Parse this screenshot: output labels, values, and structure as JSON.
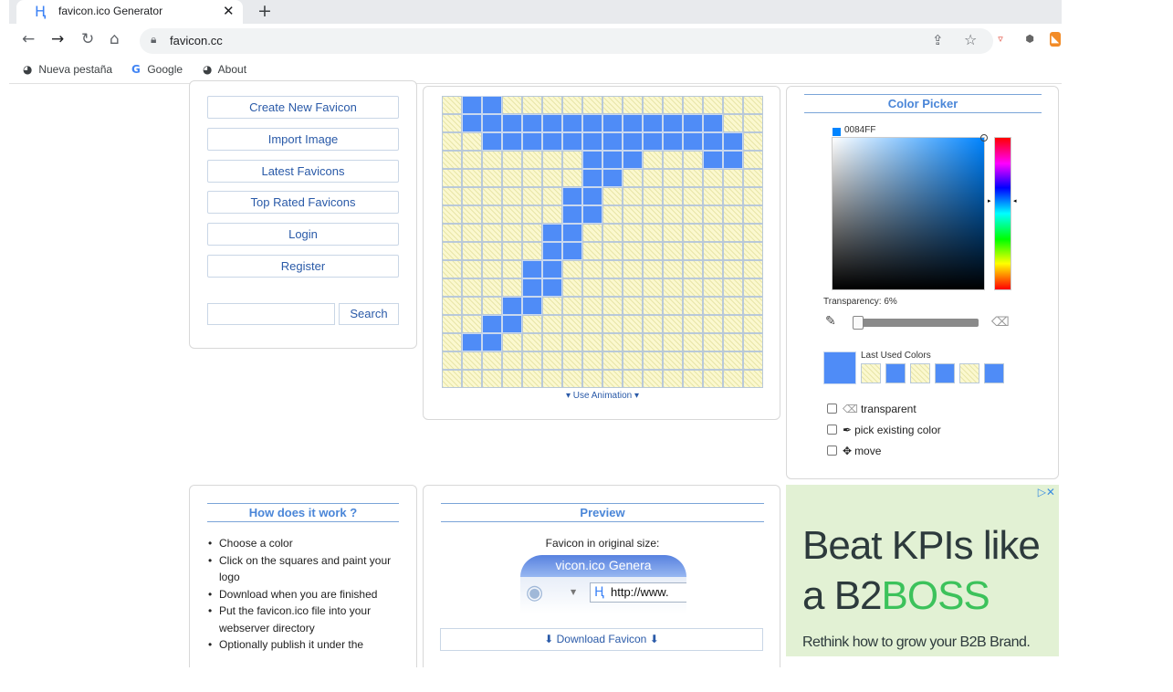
{
  "browser": {
    "tab_title": "favicon.ico Generator",
    "url": "favicon.cc",
    "bookmarks": [
      "Nueva pestaña",
      "Google",
      "About"
    ]
  },
  "menu": {
    "buttons": [
      "Create New Favicon",
      "Import Image",
      "Latest Favicons",
      "Top Rated Favicons",
      "Login",
      "Register"
    ],
    "search_label": "Search",
    "search_value": ""
  },
  "editor": {
    "grid": [
      "0110000000000000",
      "0111111111111100",
      "0011111111111110",
      "0000000111000110",
      "0000000110000000",
      "0000001100000000",
      "0000001100000000",
      "0000011000000000",
      "0000011000000000",
      "0000110000000000",
      "0000110000000000",
      "0001100000000000",
      "0011000000000000",
      "0110000000000000",
      "0000000000000000",
      "0000000000000000"
    ],
    "paint_color": "#4f8cf7",
    "animation_label": "Use Animation"
  },
  "color_picker": {
    "title": "Color Picker",
    "hex": "0084FF",
    "transparency_label": "Transparency: 6%",
    "transparency": 0.06,
    "last_used_label": "Last Used Colors",
    "last_used": [
      "transparent",
      "#4f8cf7",
      "transparent",
      "#4f8cf7",
      "transparent",
      "#4f8cf7"
    ],
    "options": [
      {
        "icon": "eraser-icon",
        "label": "transparent"
      },
      {
        "icon": "eyedropper-icon",
        "label": "pick existing color"
      },
      {
        "icon": "move-icon",
        "label": "move"
      }
    ]
  },
  "how": {
    "title": "How does it work ?",
    "steps": [
      "Choose a color",
      "Click on the squares and paint your logo",
      "Download when you are finished",
      "Put the favicon.ico file into your webserver directory",
      "Optionally publish it under the"
    ]
  },
  "preview": {
    "title": "Preview",
    "original_size_label": "Favicon in original size:",
    "window_title_fragment": "vicon.ico Genera",
    "address_text": "http://www.",
    "download_label": "Download Favicon"
  },
  "ad": {
    "line1": "Beat KPIs like",
    "line2_prefix": "a B2",
    "line2_brand": "BOSS",
    "subline": "Rethink how to grow your B2B Brand."
  }
}
